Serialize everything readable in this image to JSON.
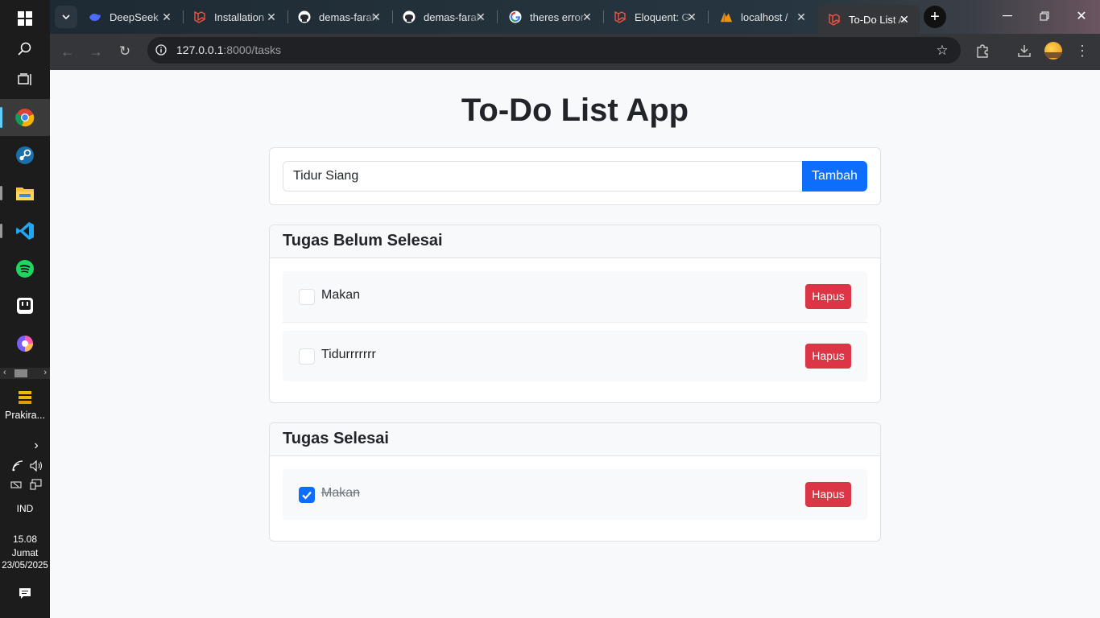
{
  "taskbar": {
    "weather_label": "Prakira...",
    "language": "IND",
    "time": "15.08",
    "day": "Jumat",
    "date": "23/05/2025",
    "apps": [
      "windows-start-icon",
      "search-icon",
      "task-view-icon",
      "chrome-icon",
      "steam-icon",
      "file-explorer-icon",
      "vscode-icon",
      "spotify-icon",
      "app-icon",
      "color-app-icon"
    ]
  },
  "browser": {
    "tabs": [
      {
        "title": "DeepSeek",
        "icon": "deepseek-icon"
      },
      {
        "title": "Installation",
        "icon": "laravel-icon"
      },
      {
        "title": "demas-farah",
        "icon": "github-icon"
      },
      {
        "title": "demas-farah",
        "icon": "github-icon"
      },
      {
        "title": "theres error",
        "icon": "google-icon"
      },
      {
        "title": "Eloquent: G",
        "icon": "laravel-icon"
      },
      {
        "title": "localhost /",
        "icon": "phpmyadmin-icon"
      },
      {
        "title": "To-Do List A",
        "icon": "laravel-icon",
        "active": true
      }
    ],
    "url_host": "127.0.0.1",
    "url_rest": ":8000/tasks"
  },
  "app": {
    "title": "To-Do List App",
    "new_task": {
      "value": "Tidur Siang",
      "button": "Tambah"
    },
    "pending": {
      "heading": "Tugas Belum Selesai",
      "items": [
        {
          "text": "Makan",
          "checked": false,
          "delete": "Hapus"
        },
        {
          "text": "Tidurrrrrrr",
          "checked": false,
          "delete": "Hapus"
        }
      ]
    },
    "completed": {
      "heading": "Tugas Selesai",
      "items": [
        {
          "text": "Makan",
          "checked": true,
          "delete": "Hapus"
        }
      ]
    }
  },
  "colors": {
    "primary": "#0d6efd",
    "danger": "#dc3545",
    "chrome_toolbar": "#35363a"
  }
}
